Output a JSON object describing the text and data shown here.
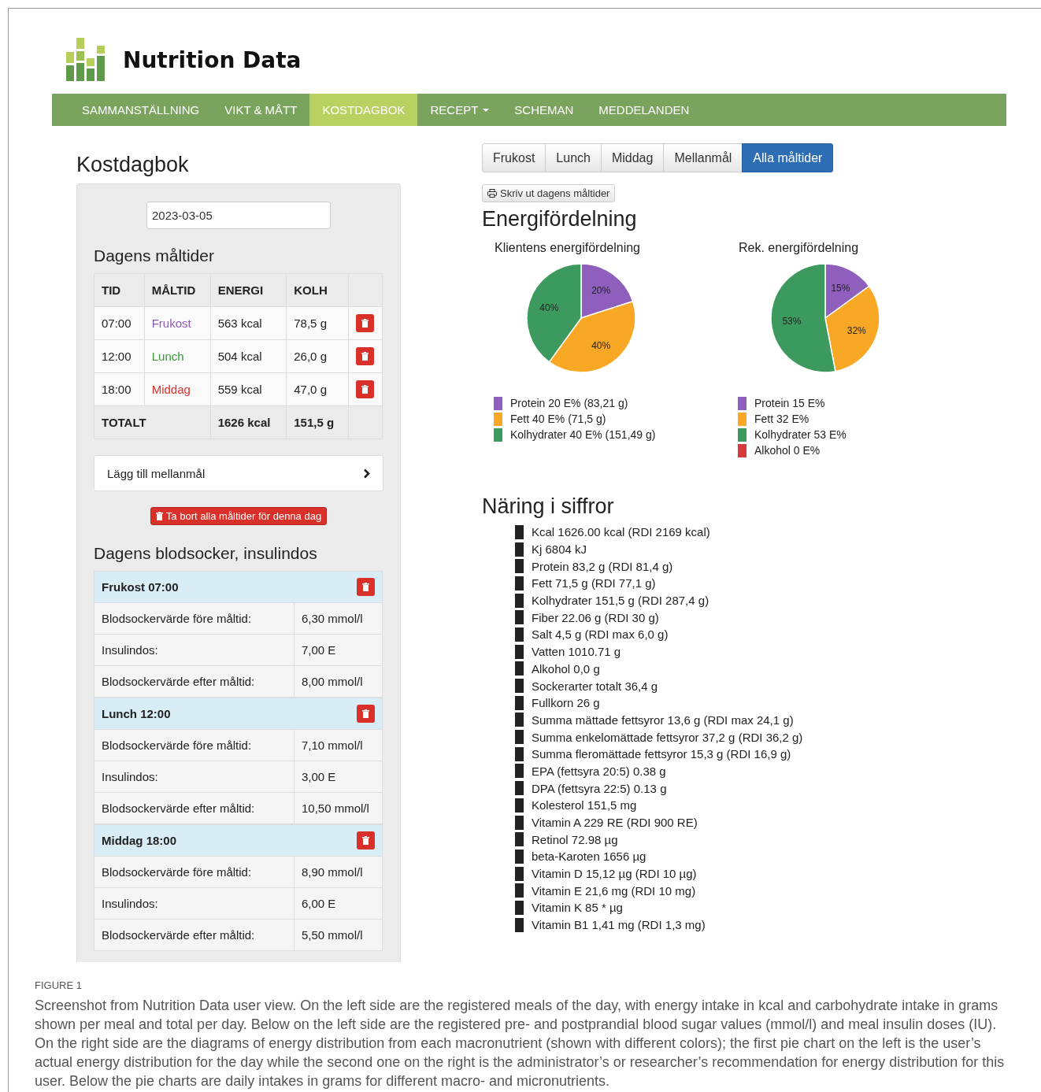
{
  "brand": {
    "name": "Nutrition Data"
  },
  "nav": [
    {
      "label": "SAMMANSTÄLLNING",
      "selected": false,
      "dropdown": false
    },
    {
      "label": "VIKT & MÅTT",
      "selected": false,
      "dropdown": false
    },
    {
      "label": "KOSTDAGBOK",
      "selected": true,
      "dropdown": false
    },
    {
      "label": "RECEPT",
      "selected": false,
      "dropdown": true
    },
    {
      "label": "SCHEMAN",
      "selected": false,
      "dropdown": false
    },
    {
      "label": "MEDDELANDEN",
      "selected": false,
      "dropdown": false
    }
  ],
  "diary": {
    "title": "Kostdagbok",
    "date": "2023-03-05",
    "meals_title": "Dagens måltider",
    "columns": [
      "TID",
      "MÅLTID",
      "ENERGI",
      "KOLH"
    ],
    "rows": [
      {
        "time": "07:00",
        "meal": "Frukost",
        "color": "#8e5bb5",
        "energy": "563 kcal",
        "carbs": "78,5 g"
      },
      {
        "time": "12:00",
        "meal": "Lunch",
        "color": "#3a9a3a",
        "energy": "504 kcal",
        "carbs": "26,0 g"
      },
      {
        "time": "18:00",
        "meal": "Middag",
        "color": "#d9302a",
        "energy": "559 kcal",
        "carbs": "47,0 g"
      }
    ],
    "total": {
      "label": "TOTALT",
      "energy": "1626 kcal",
      "carbs": "151,5 g"
    },
    "add_snack": "Lägg till mellanmål",
    "delete_all": "Ta bort alla måltider för denna dag",
    "blood_title": "Dagens blodsocker, insulindos",
    "blood": [
      {
        "title": "Frukost 07:00",
        "rows": [
          {
            "label": "Blodsockervärde före måltid:",
            "value": "6,30 mmol/l"
          },
          {
            "label": "Insulindos:",
            "value": "7,00 E"
          },
          {
            "label": "Blodsockervärde efter måltid:",
            "value": "8,00 mmol/l"
          }
        ]
      },
      {
        "title": "Lunch 12:00",
        "rows": [
          {
            "label": "Blodsockervärde före måltid:",
            "value": "7,10 mmol/l"
          },
          {
            "label": "Insulindos:",
            "value": "3,00 E"
          },
          {
            "label": "Blodsockervärde efter måltid:",
            "value": "10,50 mmol/l"
          }
        ]
      },
      {
        "title": "Middag 18:00",
        "rows": [
          {
            "label": "Blodsockervärde före måltid:",
            "value": "8,90 mmol/l"
          },
          {
            "label": "Insulindos:",
            "value": "6,00 E"
          },
          {
            "label": "Blodsockervärde efter måltid:",
            "value": "5,50 mmol/l"
          }
        ]
      }
    ]
  },
  "meal_tabs": [
    {
      "label": "Frukost",
      "selected": false
    },
    {
      "label": "Lunch",
      "selected": false
    },
    {
      "label": "Middag",
      "selected": false
    },
    {
      "label": "Mellanmål",
      "selected": false
    },
    {
      "label": "Alla måltider",
      "selected": true
    }
  ],
  "print_button": "Skriv ut dagens måltider",
  "energy": {
    "title": "Energifördelning",
    "charts": [
      {
        "chart_data": {
          "type": "pie",
          "title": "Klientens energifördelning",
          "values": [
            20,
            40,
            40
          ],
          "value_labels": [
            "20%",
            "40%",
            "40%"
          ]
        },
        "legend": [
          {
            "label": "Protein 20 E% (83,21 g)",
            "color": "#8e5fbd"
          },
          {
            "label": "Fett 40 E% (71,5 g)",
            "color": "#f9a825"
          },
          {
            "label": "Kolhydrater 40 E% (151,49 g)",
            "color": "#3d9a5f"
          }
        ]
      },
      {
        "chart_data": {
          "type": "pie",
          "title": "Rek. energifördelning",
          "values": [
            15,
            32,
            53,
            0
          ],
          "value_labels": [
            "15%",
            "32%",
            "53%",
            null
          ]
        },
        "legend": [
          {
            "label": "Protein 15 E%",
            "color": "#8e5fbd"
          },
          {
            "label": "Fett 32 E%",
            "color": "#f9a825"
          },
          {
            "label": "Kolhydrater 53 E%",
            "color": "#3d9a5f"
          },
          {
            "label": "Alkohol 0 E%",
            "color": "#d63a3a"
          }
        ]
      }
    ]
  },
  "nutrition": {
    "title": "Näring i siffror",
    "items": [
      "Kcal 1626.00 kcal (RDI 2169 kcal)",
      "Kj 6804 kJ",
      "Protein 83,2 g (RDI 81,4 g)",
      "Fett 71,5 g (RDI 77,1 g)",
      "Kolhydrater 151,5 g (RDI 287,4 g)",
      "Fiber 22.06 g (RDI 30 g)",
      "Salt 4,5 g (RDI max 6,0 g)",
      "Vatten 1010.71 g",
      "Alkohol 0,0 g",
      "Sockerarter totalt 36,4 g",
      "Fullkorn 26 g",
      "Summa mättade fettsyror 13,6 g (RDI max 24,1 g)",
      "Summa enkelomättade fettsyror 37,2 g (RDI 36,2 g)",
      "Summa fleromättade fettsyror 15,3 g (RDI 16,9 g)",
      "EPA (fettsyra 20:5) 0.38 g",
      "DPA (fettsyra 22:5) 0.13 g",
      "Kolesterol 151,5 mg",
      "Vitamin A 229 RE (RDI 900 RE)",
      "Retinol 72.98 µg",
      "beta-Karoten 1656 µg",
      "Vitamin D 15,12 µg (RDI 10 µg)",
      "Vitamin E 21,6 mg (RDI 10 mg)",
      "Vitamin K 85 * µg",
      "Vitamin B1 1,41 mg (RDI 1,3 mg)"
    ]
  },
  "caption": {
    "label": "FIGURE 1",
    "text": "Screenshot from Nutrition Data user view. On the left side are the registered meals of the day, with energy intake in kcal and carbohydrate intake in grams shown per meal and total per day. Below on the left side are the registered pre- and postprandial blood sugar values (mmol/l) and meal insulin doses (IU). On the right side are the diagrams of energy distribution from each macronutrient (shown with different colors); the first pie chart on the left is the user’s actual energy distribution for the day while the second one on the right is the administrator’s or researcher’s recommendation for energy distribution for this user. Below the pie charts are daily intakes in grams for different macro- and micronutrients."
  }
}
